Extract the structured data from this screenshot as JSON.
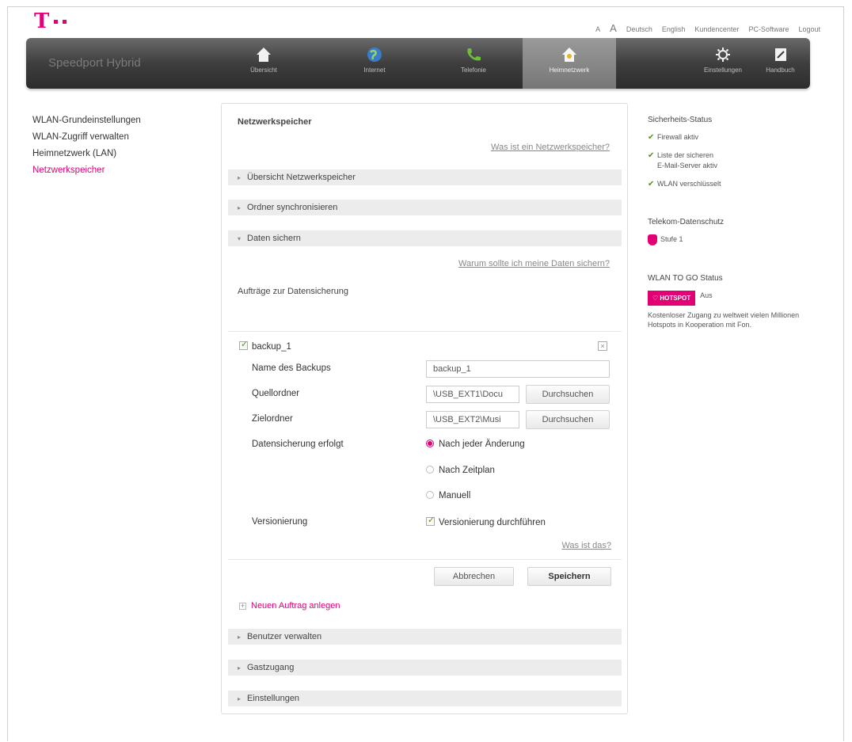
{
  "header": {
    "logo_letter": "T",
    "toplinks": {
      "font_small": "A",
      "font_large": "A",
      "deutsch": "Deutsch",
      "english": "English",
      "kundencenter": "Kundencenter",
      "pc_software": "PC-Software",
      "logout": "Logout"
    }
  },
  "nav": {
    "brand": "Speedport Hybrid",
    "items": [
      {
        "label": "Übersicht",
        "icon": "home-icon"
      },
      {
        "label": "Internet",
        "icon": "globe-icon"
      },
      {
        "label": "Telefonie",
        "icon": "phone-icon"
      },
      {
        "label": "Heimnetzwerk",
        "icon": "home-network-icon"
      },
      {
        "label": "Einstellungen",
        "icon": "gear-icon"
      },
      {
        "label": "Handbuch",
        "icon": "book-icon"
      }
    ],
    "active_item": "Heimnetzwerk"
  },
  "sidebar": {
    "items": [
      {
        "label": "WLAN-Grundeinstellungen"
      },
      {
        "label": "WLAN-Zugriff verwalten"
      },
      {
        "label": "Heimnetzwerk (LAN)"
      },
      {
        "label": "Netzwerkspeicher"
      }
    ],
    "active_item": "Netzwerkspeicher"
  },
  "main": {
    "title": "Netzwerkspeicher",
    "help_link": "Was ist ein Netzwerkspeicher?",
    "sections": {
      "overview": "Übersicht Netzwerkspeicher",
      "sync": "Ordner synchronisieren",
      "backup": "Daten sichern",
      "users": "Benutzer verwalten",
      "guest": "Gastzugang",
      "settings": "Einstellungen"
    },
    "backup_help_link": "Warum sollte ich meine Daten sichern?",
    "jobs_title": "Aufträge zur Datensicherung",
    "job": {
      "name": "backup_1",
      "enabled": true,
      "name_label": "Name des Backups",
      "name_value": "backup_1",
      "source_label": "Quellordner",
      "source_value": "\\USB_EXT1\\Docu",
      "target_label": "Zielordner",
      "target_value": "\\USB_EXT2\\Musi",
      "browse_label": "Durchsuchen",
      "schedule_label": "Datensicherung erfolgt",
      "schedule_options": [
        "Nach jeder Änderung",
        "Nach Zeitplan",
        "Manuell"
      ],
      "schedule_selected": "Nach jeder Änderung",
      "versioning_label": "Versionierung",
      "versioning_option": "Versionierung durchführen",
      "versioning_checked": true,
      "versioning_help": "Was ist das?",
      "cancel_label": "Abbrechen",
      "save_label": "Speichern"
    },
    "new_job_label": "Neuen Auftrag anlegen"
  },
  "status": {
    "security_title": "Sicherheits-Status",
    "security_items": [
      "Firewall aktiv",
      "Liste der sicheren",
      "E-Mail-Server aktiv",
      "WLAN verschlüsselt"
    ],
    "privacy_title": "Telekom-Datenschutz",
    "privacy_level": "Stufe 1",
    "wlan_to_go_title": "WLAN TO GO Status",
    "hotspot_badge": "HOTSPOT",
    "hotspot_state": "Aus",
    "hotspot_text": "Kostenloser Zugang zu weltweit vielen Millionen Hotspots in Kooperation mit Fon."
  },
  "colors": {
    "accent": "#e20074",
    "check": "#5b8f22"
  }
}
